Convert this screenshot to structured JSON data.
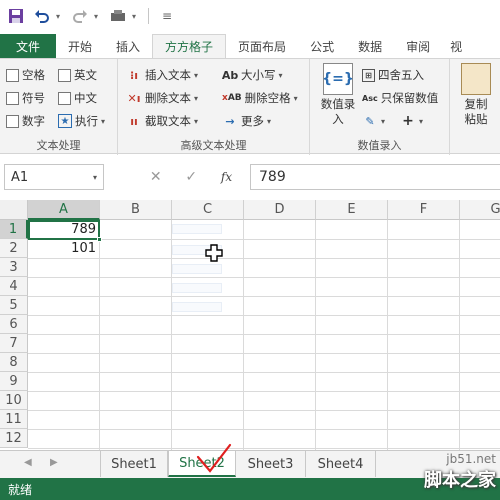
{
  "colors": {
    "accent": "#217346",
    "ribbon_bg": "#f3f3f3",
    "grid_line": "#dadada"
  },
  "quick_access": {
    "icons": [
      "save-icon",
      "undo-icon",
      "redo-icon",
      "toolbar-icon",
      "customize-icon"
    ]
  },
  "tabs": [
    "文件",
    "开始",
    "插入",
    "方方格子",
    "页面布局",
    "公式",
    "数据",
    "审阅",
    "视"
  ],
  "active_tab": "方方格子",
  "ribbon": {
    "text_group": {
      "label": "文本处理",
      "items": [
        "空格",
        "英文",
        "符号",
        "中文",
        "数字",
        "执行"
      ]
    },
    "adv_group": {
      "label": "高级文本处理",
      "insert_text": "插入文本",
      "delete_text": "删除文本",
      "extract_text": "截取文本",
      "case": "大小写",
      "delete_space": "删除空格",
      "more": "更多",
      "icon_ab": "Ab",
      "icon_xab": "AB"
    },
    "entry_group": {
      "label": "数值录入",
      "big_label": "数值录入",
      "round": "四舍五入",
      "keep_value": "只保留数值",
      "abc": "Asc",
      "big_icon_text": "{=}"
    },
    "paste": {
      "label": "复制粘贴"
    }
  },
  "formula_bar": {
    "name_box": "A1",
    "fx": "fx",
    "value": "789"
  },
  "grid": {
    "columns": [
      "A",
      "B",
      "C",
      "D",
      "E",
      "F",
      "G"
    ],
    "rows": [
      "1",
      "2",
      "3",
      "4",
      "5",
      "6",
      "7",
      "8",
      "9",
      "10",
      "11",
      "12"
    ],
    "cells": {
      "A1": "789",
      "A2": "101"
    }
  },
  "sheets": [
    "Sheet1",
    "Sheet2",
    "Sheet3",
    "Sheet4"
  ],
  "active_sheet": "Sheet2",
  "status": "就绪",
  "watermark": {
    "url": "jb51.net",
    "name": "脚本之家"
  }
}
